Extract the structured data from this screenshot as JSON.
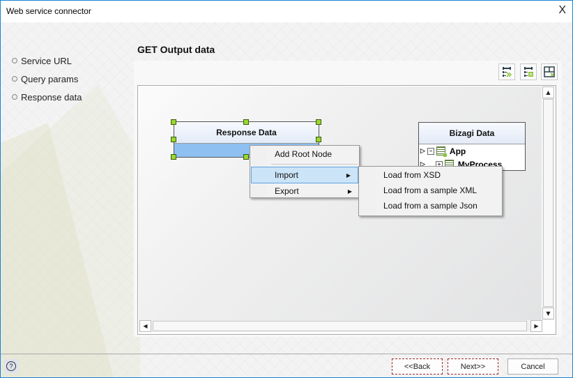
{
  "window": {
    "title": "Web service connector",
    "close_glyph": "X"
  },
  "sidebar": {
    "items": [
      {
        "label": "Service URL"
      },
      {
        "label": "Query params"
      },
      {
        "label": "Response data"
      }
    ]
  },
  "main": {
    "heading": "GET Output data",
    "toolbar": [
      {
        "icon": "auto-map-icon"
      },
      {
        "icon": "map-list-icon"
      },
      {
        "icon": "layout-icon"
      }
    ]
  },
  "diagram": {
    "response_entity": {
      "title": "Response Data"
    },
    "bizagi_entity": {
      "title": "Bizagi Data",
      "rows": [
        {
          "expander": "▷",
          "toggle": "−",
          "label": "App"
        },
        {
          "expander": "▷",
          "toggle": "+",
          "label": "MyProcess"
        }
      ]
    }
  },
  "context_menu": {
    "items": [
      {
        "label": "Add Root Node"
      },
      {
        "label": "Import",
        "submenu": true
      },
      {
        "label": "Export",
        "submenu": true
      }
    ],
    "submenu": {
      "items": [
        {
          "label": "Load from XSD"
        },
        {
          "label": "Load from a sample XML"
        },
        {
          "label": "Load from a sample Json"
        }
      ]
    }
  },
  "scrollbar": {
    "up": "▲",
    "down": "▼",
    "left": "◀",
    "right": "▶"
  },
  "footer": {
    "help": "?",
    "back_label": "<<Back",
    "next_label": "Next>>",
    "cancel_label": "Cancel"
  }
}
